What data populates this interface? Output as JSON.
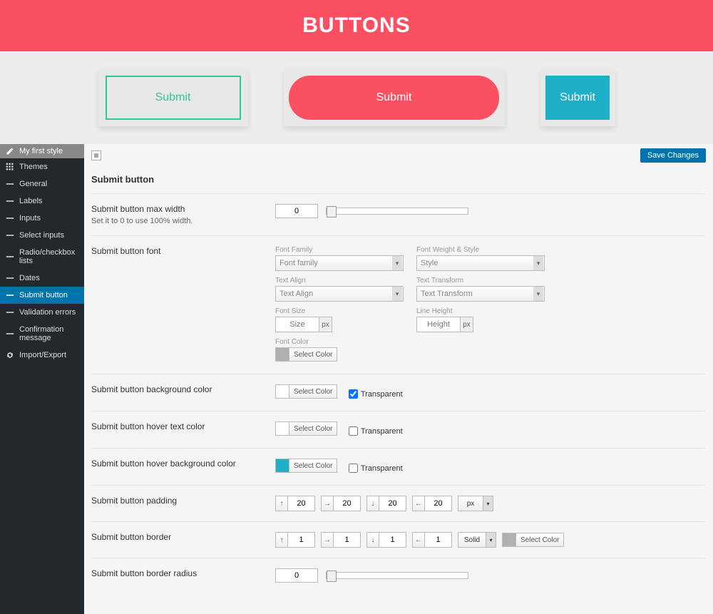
{
  "hero": {
    "title": "BUTTONS"
  },
  "preview": {
    "btn1": "Submit",
    "btn2": "Submit",
    "btn3": "Submit"
  },
  "sidebar": {
    "top": "My first style",
    "items": [
      "Themes",
      "General",
      "Labels",
      "Inputs",
      "Select inputs",
      "Radio/checkbox lists",
      "Dates",
      "Submit button",
      "Validation errors",
      "Confirmation message",
      "Import/Export"
    ]
  },
  "toolbar": {
    "save": "Save Changes"
  },
  "section": {
    "title": "Submit button"
  },
  "rows": {
    "maxwidth": {
      "label": "Submit button max width",
      "hint": "Set it to 0 to use 100% width.",
      "value": "0"
    },
    "font": {
      "label": "Submit button font",
      "family_lbl": "Font Family",
      "family_ph": "Font family",
      "weight_lbl": "Font Weight & Style",
      "weight_ph": "Style",
      "align_lbl": "Text Align",
      "align_ph": "Text Align",
      "transform_lbl": "Text Transform",
      "transform_ph": "Text Transform",
      "size_lbl": "Font Size",
      "size_ph": "Size",
      "size_unit": "px",
      "lh_lbl": "Line Height",
      "lh_ph": "Height",
      "lh_unit": "px",
      "color_lbl": "Font Color",
      "select_color": "Select Color"
    },
    "bg": {
      "label": "Submit button background color",
      "select_color": "Select Color",
      "transparent": "Transparent",
      "checked": true
    },
    "hovertext": {
      "label": "Submit button hover text color",
      "select_color": "Select Color",
      "transparent": "Transparent",
      "checked": false
    },
    "hoverbg": {
      "label": "Submit button hover background color",
      "select_color": "Select Color",
      "transparent": "Transparent",
      "checked": false
    },
    "padding": {
      "label": "Submit button padding",
      "top": "20",
      "right": "20",
      "bottom": "20",
      "left": "20",
      "unit": "px"
    },
    "border": {
      "label": "Submit button border",
      "top": "1",
      "right": "1",
      "bottom": "1",
      "left": "1",
      "style": "Solid",
      "select_color": "Select Color"
    },
    "radius": {
      "label": "Submit button border radius",
      "value": "0"
    }
  }
}
